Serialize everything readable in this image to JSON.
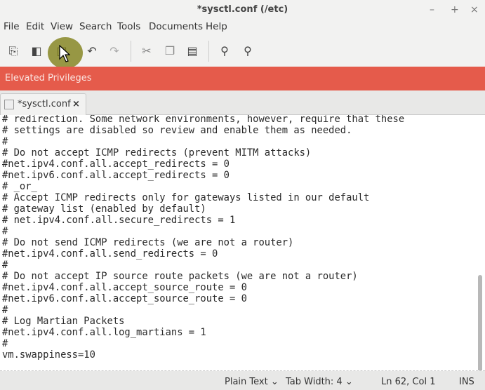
{
  "window": {
    "title": "*sysctl.conf (/etc)",
    "controls": [
      "–",
      "+",
      "×"
    ]
  },
  "menu": [
    "File",
    "Edit",
    "View",
    "Search",
    "Tools",
    "Documents",
    "Help"
  ],
  "toolbar": [
    {
      "icon": "new-document-icon",
      "glyph": "⎘"
    },
    {
      "icon": "open-icon",
      "glyph": "◧"
    },
    {
      "icon": "save-icon",
      "glyph": "▣"
    },
    {
      "icon": "undo-icon",
      "glyph": "↶"
    },
    {
      "icon": "redo-icon",
      "glyph": "↷"
    },
    {
      "icon": "cut-icon",
      "glyph": "✂"
    },
    {
      "icon": "copy-icon",
      "glyph": "❐"
    },
    {
      "icon": "paste-icon",
      "glyph": "▤"
    },
    {
      "icon": "search-icon",
      "glyph": "⚲"
    },
    {
      "icon": "search-replace-icon",
      "glyph": "⚲"
    }
  ],
  "banner": "Elevated Privileges",
  "accent": "#e55b4b",
  "tab": {
    "label": "*sysctl.conf",
    "close": "×"
  },
  "lines": [
    "# redirection. Some network environments, however, require that these",
    "# settings are disabled so review and enable them as needed.",
    "#",
    "# Do not accept ICMP redirects (prevent MITM attacks)",
    "#net.ipv4.conf.all.accept_redirects = 0",
    "#net.ipv6.conf.all.accept_redirects = 0",
    "# _or_",
    "# Accept ICMP redirects only for gateways listed in our default",
    "# gateway list (enabled by default)",
    "# net.ipv4.conf.all.secure_redirects = 1",
    "#",
    "# Do not send ICMP redirects (we are not a router)",
    "#net.ipv4.conf.all.send_redirects = 0",
    "#",
    "# Do not accept IP source route packets (we are not a router)",
    "#net.ipv4.conf.all.accept_source_route = 0",
    "#net.ipv6.conf.all.accept_source_route = 0",
    "#",
    "# Log Martian Packets",
    "#net.ipv4.conf.all.log_martians = 1",
    "#",
    "vm.swappiness=10"
  ],
  "status": {
    "language": "Plain Text ⌄",
    "tab_width": "Tab Width:  4 ⌄",
    "position": "Ln 62, Col 1",
    "mode": "INS"
  }
}
